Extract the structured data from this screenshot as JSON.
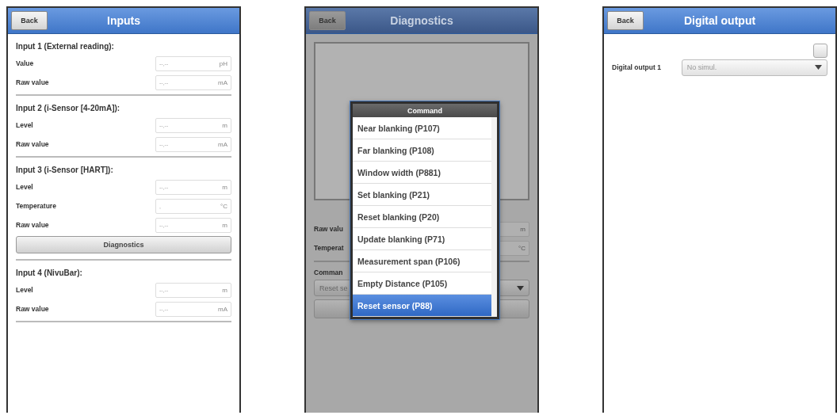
{
  "screens": [
    {
      "kind": "inputs",
      "back": "Back",
      "title": "Inputs",
      "sections": [
        {
          "title": "Input 1 (External reading):",
          "rows": [
            {
              "label": "Value",
              "value": "--,--",
              "unit": "pH"
            },
            {
              "label": "Raw value",
              "value": "--,--",
              "unit": "mA"
            }
          ]
        },
        {
          "title": "Input 2 (i-Sensor [4-20mA]):",
          "rows": [
            {
              "label": "Level",
              "value": "--,--",
              "unit": "m"
            },
            {
              "label": "Raw value",
              "value": "--,--",
              "unit": "mA"
            }
          ]
        },
        {
          "title": "Input 3 (i-Sensor [HART]):",
          "rows": [
            {
              "label": "Level",
              "value": "--,--",
              "unit": "m"
            },
            {
              "label": "Temperature",
              "value": ",",
              "unit": "°C"
            },
            {
              "label": "Raw value",
              "value": "--,--",
              "unit": "m"
            }
          ],
          "button": "Diagnostics"
        },
        {
          "title": "Input 4 (NivuBar):",
          "rows": [
            {
              "label": "Level",
              "value": "--,--",
              "unit": "m"
            },
            {
              "label": "Raw value",
              "value": "--,--",
              "unit": "mA"
            }
          ]
        }
      ]
    },
    {
      "kind": "diagnostics",
      "back": "Back",
      "title": "Diagnostics",
      "rows": [
        {
          "label": "Raw valu",
          "unit": "m"
        },
        {
          "label": "Temperat",
          "unit": "°C"
        }
      ],
      "command_label": "Comman",
      "command_value": "Reset se",
      "popup": {
        "title": "Command",
        "options": [
          {
            "label": "Near blanking (P107)",
            "selected": false
          },
          {
            "label": "Far blanking (P108)",
            "selected": false
          },
          {
            "label": "Window width (P881)",
            "selected": false
          },
          {
            "label": "Set blanking (P21)",
            "selected": false
          },
          {
            "label": "Reset blanking (P20)",
            "selected": false
          },
          {
            "label": "Update blanking (P71)",
            "selected": false
          },
          {
            "label": "Measurement span (P106)",
            "selected": false
          },
          {
            "label": "Empty Distance (P105)",
            "selected": false
          },
          {
            "label": "Reset sensor (P88)",
            "selected": true
          }
        ]
      }
    },
    {
      "kind": "digital_output",
      "back": "Back",
      "title": "Digital output",
      "checkbox": {
        "checked": false
      },
      "rows": [
        {
          "label": "Digital output 1",
          "value": "No simul."
        }
      ]
    }
  ]
}
